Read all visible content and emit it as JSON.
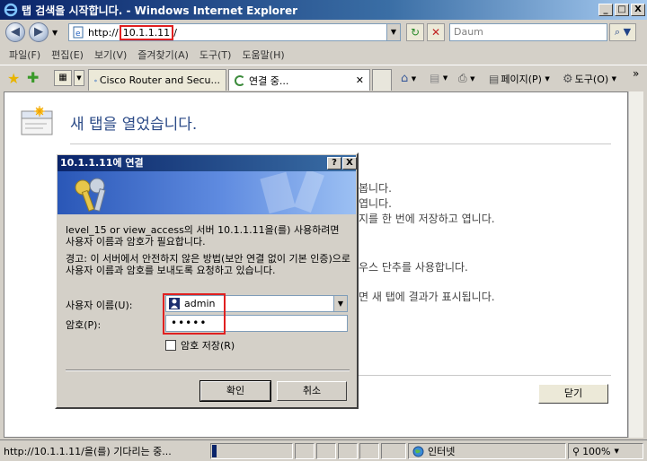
{
  "window": {
    "title": "탭 검색을 시작합니다. - Windows Internet Explorer",
    "caption_buttons": [
      "_",
      "□",
      "X"
    ]
  },
  "address_bar": {
    "url_prefix": "http://",
    "url_host": "10.1.1.11",
    "url_suffix": "/",
    "search_placeholder": "Daum",
    "search_go": "⌕"
  },
  "menu": [
    "파일(F)",
    "편집(E)",
    "보기(V)",
    "즐겨찾기(A)",
    "도구(T)",
    "도움말(H)"
  ],
  "tabs": [
    {
      "label": "Cisco Router and Secu..."
    },
    {
      "label": "연결 중..."
    }
  ],
  "command_bar": {
    "page": "페이지(P)",
    "tools": "도구(O)",
    "chevron": "»"
  },
  "newtab": {
    "title": "새 탭을 열었습니다.",
    "bg_lines": [
      "봅니다.",
      "엽니다.",
      "지를 한 번에 저장하고 엽니다.",
      "우스 단추를 사용합니다.",
      "면 새 탭에 결과가 표시됩니다."
    ],
    "close_label": "닫기"
  },
  "dialog": {
    "title": "10.1.1.11에 연결",
    "description": "level_15 or view_access의 서버 10.1.1.11을(를) 사용하려면 사용자 이름과 암호가 필요합니다.",
    "warning": "경고: 이 서버에서 안전하지 않은 방법(보안 연결 없이 기본 인증)으로 사용자 이름과 암호를 보내도록 요청하고 있습니다.",
    "username_label": "사용자 이름(U):",
    "username_value": "admin",
    "password_label": "암호(P):",
    "password_value": "•••••",
    "remember_label": "암호 저장(R)",
    "ok_label": "확인",
    "cancel_label": "취소"
  },
  "status": {
    "text": "http://10.1.1.11/을(를) 기다리는 중...",
    "zone": "인터넷",
    "zoom": "100%"
  },
  "colors": {
    "highlight_red": "#e02020",
    "titlebar": "#0a246a"
  }
}
